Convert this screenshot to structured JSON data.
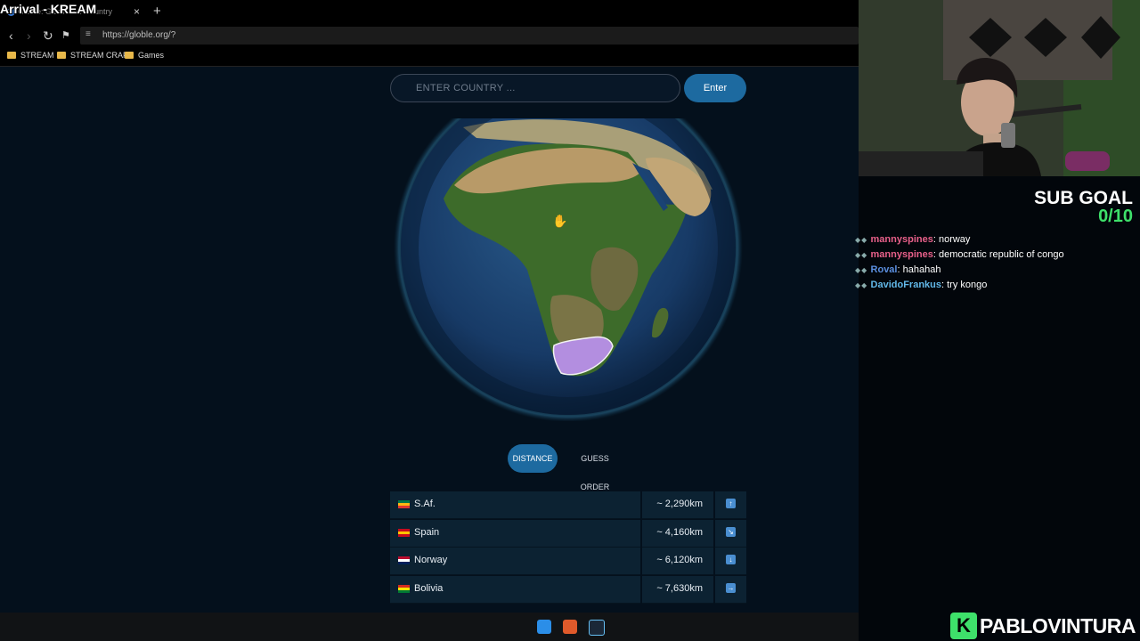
{
  "browser": {
    "overlay_title": "Arrival - KREAM",
    "tab_title": "Globle: Guess the Country",
    "new_tab": "+",
    "close": "×",
    "back": "‹",
    "forward": "›",
    "reload": "↻",
    "bookmark": "⚑",
    "url": "https://globle.org/?",
    "bookmarks": [
      "STREAM",
      "STREAM CRAP",
      "Games"
    ]
  },
  "game": {
    "search_placeholder": "ENTER COUNTRY ...",
    "enter_label": "Enter",
    "modes": {
      "distance": "DISTANCE",
      "guess_order": "GUESS ORDER"
    },
    "guesses": [
      {
        "country": "S.Af.",
        "distance": "~ 2,290km",
        "direction": "↑",
        "flag": "south-africa"
      },
      {
        "country": "Spain",
        "distance": "~ 4,160km",
        "direction": "↘",
        "flag": "spain"
      },
      {
        "country": "Norway",
        "distance": "~ 6,120km",
        "direction": "↓",
        "flag": "norway"
      },
      {
        "country": "Bolivia",
        "distance": "~ 7,630km",
        "direction": "→",
        "flag": "bolivia"
      }
    ]
  },
  "stream": {
    "sub_goal_title": "SUB GOAL",
    "sub_goal_count": "0/10",
    "chat": [
      {
        "user": "mannyspines",
        "color": "#e8608a",
        "text": "norway"
      },
      {
        "user": "mannyspines",
        "color": "#e8608a",
        "text": "democratic republic of congo"
      },
      {
        "user": "Roval",
        "color": "#5b8fe0",
        "text": "hahahah"
      },
      {
        "user": "DavidoFrankus",
        "color": "#62b8e8",
        "text": "try kongo"
      }
    ],
    "brand_letter": "K",
    "brand_name": "PABLOVINTURA"
  }
}
